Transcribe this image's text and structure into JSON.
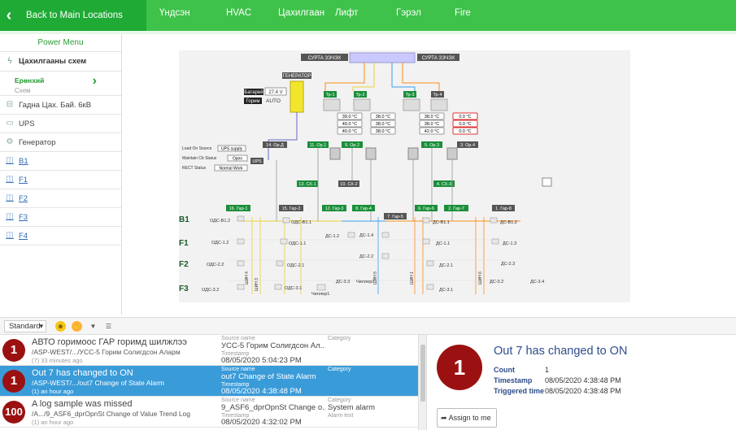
{
  "topbar": {
    "back_label": "Back to Main Locations",
    "tabs": [
      "Үндсэн",
      "HVAC",
      "Цахилгаан",
      "Лифт",
      "Гэрэл",
      "Fire"
    ]
  },
  "sidebar": {
    "title": "Power Menu",
    "section": "Цахилгааны схем",
    "selected_title": "Ерөнхий",
    "selected_sub": "Схем",
    "items": [
      {
        "label": "Гадна Цах. Бай. 6кВ",
        "icon": "plug-icon"
      },
      {
        "label": "UPS",
        "icon": "ups-icon"
      },
      {
        "label": "Генератор",
        "icon": "generator-icon"
      },
      {
        "label": "B1",
        "icon": "floor-icon"
      },
      {
        "label": "F1",
        "icon": "floor-icon"
      },
      {
        "label": "F2",
        "icon": "floor-icon"
      },
      {
        "label": "F3",
        "icon": "floor-icon"
      },
      {
        "label": "F4",
        "icon": "floor-icon"
      }
    ]
  },
  "diagram": {
    "top_left": "СУРТА ЗЭЧЭХ",
    "top_right": "СУРТА ЗЭЧЭХ",
    "generator": "ГЕНЕРАТОР",
    "battery_label": "Батарей",
    "battery_value": "27.4 V",
    "mode_label": "Горим",
    "mode_value": "AUTO",
    "transformers": [
      "Тр-1",
      "Тр-2",
      "Тр-3",
      "Тр-4"
    ],
    "temps": [
      [
        "39.0 °C",
        "40.0 °C",
        "40.0 °C"
      ],
      [
        "38.0 °C",
        "38.0 °C",
        "38.0 °C"
      ],
      [
        "38.0 °C",
        "38.0 °C",
        "42.0 °C"
      ],
      [
        "0.0 °C",
        "0.0 °C",
        "0.0 °C"
      ]
    ],
    "load_on_source": "Load On Source",
    "load_val": "UPS supply",
    "maintain_cb": "Maintain Cb Status",
    "maintain_val": "Open",
    "rect_status": "RECT Status",
    "rect_val": "Normal Work",
    "ups": "UPS",
    "panels": [
      "14. Ор.Д",
      "11. Ор.1",
      "9. Ор.2",
      "5. Ор.3",
      "3. Ор.4"
    ],
    "cx": [
      "13. СХ-1",
      "10. СХ-2",
      "4. СХ-3"
    ],
    "gars": [
      "16. Гар-1",
      "15. Гар-2",
      "12. Гар-3",
      "8. Гар-4",
      "7. Гар-5",
      "6. Гар-6",
      "2. Гар-7",
      "1. Гар-8"
    ],
    "floors": [
      "B1",
      "F1",
      "F2",
      "F3"
    ],
    "labels": [
      "ОДС-В1.2",
      "ОДС-В1.1",
      "ДС-В1.1",
      "ДС-В1.2",
      "ОДС-1.2",
      "ОДС-1.1",
      "ДС-1.2",
      "ДС-1.4",
      "ДС-1.1",
      "ДС-1.3",
      "ОДС-2.2",
      "ОДС-2.1",
      "ДС-2.2",
      "ДС-2.1",
      "ДС-2.3",
      "ОДС-3.2",
      "ОДС-3.1",
      "ДС-3.3",
      "Чиллер2",
      "Чиллер1",
      "ДС-3.1",
      "ДС-3.2",
      "ДС-3.4"
    ],
    "shin": [
      "ШИН 4",
      "ШИН 3",
      "ШИН 5",
      "ШИН 1",
      "ШИН 6"
    ]
  },
  "toolbar": {
    "view_select": "Standard"
  },
  "alarms": [
    {
      "count": "1",
      "title": "АВТО горимоос ГАР горимд шилжлээ",
      "path": "/ASP-WEST/.../УСС-5 Горим Солигдсон Аларм",
      "ago": "(7) 33 minutes ago",
      "source_label": "Source name",
      "source": "УСС-5 Горим Солигдсон Ал...",
      "time_label": "Timestamp",
      "time": "08/05/2020 5:04:23 PM",
      "cat_label": "Category",
      "category": ""
    },
    {
      "count": "1",
      "title": "Out 7 has changed to ON",
      "path": "/ASP-WEST/.../out7 Change of State Alarm",
      "ago": "(1) an hour ago",
      "source_label": "Source name",
      "source": "out7 Change of State Alarm",
      "time_label": "Timestamp",
      "time": "08/05/2020 4:38:48 PM",
      "cat_label": "Category",
      "category": ""
    },
    {
      "count": "100",
      "title": "A log sample was missed",
      "path": "/A.../9_ASF6_dprOpnSt Change of Value Trend Log",
      "ago": "(1) an hour ago",
      "source_label": "Source name",
      "source": "9_ASF6_dprOpnSt Change o...",
      "time_label": "Timestamp",
      "time": "08/05/2020 4:32:02 PM",
      "cat_label": "Category",
      "category": "System alarm",
      "extra_label": "Alarm text"
    }
  ],
  "detail": {
    "count_badge": "1",
    "title": "Out 7 has changed to ON",
    "count_label": "Count",
    "count_value": "1",
    "timestamp_label": "Timestamp",
    "timestamp_value": "08/05/2020 4:38:48 PM",
    "triggered_label": "Triggered time",
    "triggered_value": "08/05/2020 4:38:48 PM",
    "assign_label": "Assign to me"
  },
  "colors": {
    "green": "#3ec24a",
    "dark_green": "#1faa35",
    "alarm_red": "#9b1111",
    "selected_blue": "#3a9bd9",
    "title_blue": "#2e4d8a"
  }
}
